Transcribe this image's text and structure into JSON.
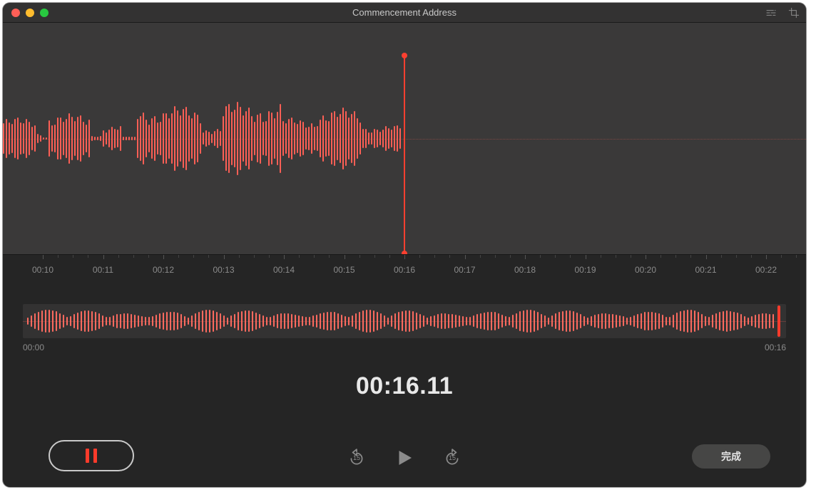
{
  "window": {
    "title": "Commencement Address"
  },
  "colors": {
    "accent": "#fc5f55",
    "accent_bright": "#fc3b2b",
    "panel": "#3a3939",
    "bg": "#252525"
  },
  "ruler": {
    "ticks": [
      "00:10",
      "00:11",
      "00:12",
      "00:13",
      "00:14",
      "00:15",
      "00:16",
      "00:17",
      "00:18",
      "00:19",
      "00:20",
      "00:21",
      "00:22"
    ],
    "playhead_tick_index": 6
  },
  "overview": {
    "start_label": "00:00",
    "end_label": "00:16"
  },
  "timer": {
    "display": "00:16.11"
  },
  "controls": {
    "record_state": "recording",
    "skip_back_seconds": "15",
    "skip_forward_seconds": "15",
    "done_label": "完成"
  },
  "icons": {
    "settings": "sliders-icon",
    "trim": "crop-icon",
    "pause": "pause-icon",
    "play": "play-icon",
    "skip_back": "skip-back-15-icon",
    "skip_forward": "skip-forward-15-icon"
  }
}
